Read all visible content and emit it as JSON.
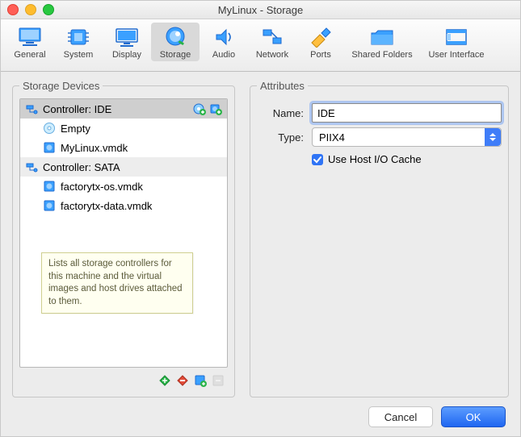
{
  "window": {
    "title": "MyLinux - Storage"
  },
  "toolbar": {
    "items": [
      {
        "label": "General"
      },
      {
        "label": "System"
      },
      {
        "label": "Display"
      },
      {
        "label": "Storage"
      },
      {
        "label": "Audio"
      },
      {
        "label": "Network"
      },
      {
        "label": "Ports"
      },
      {
        "label": "Shared Folders"
      },
      {
        "label": "User Interface"
      }
    ]
  },
  "storage": {
    "panel_title": "Storage Devices",
    "tree": {
      "ide": {
        "label": "Controller: IDE",
        "children": [
          {
            "label": "Empty"
          },
          {
            "label": "MyLinux.vmdk"
          }
        ]
      },
      "sata": {
        "label": "Controller: SATA",
        "children": [
          {
            "label": "factorytx-os.vmdk"
          },
          {
            "label": "factorytx-data.vmdk"
          }
        ]
      }
    },
    "tooltip": "Lists all storage controllers for this machine and the virtual images and host drives attached to them."
  },
  "attributes": {
    "panel_title": "Attributes",
    "name_label": "Name:",
    "name_value": "IDE",
    "type_label": "Type:",
    "type_value": "PIIX4",
    "use_host_io_label": "Use Host I/O Cache",
    "use_host_io_checked": true
  },
  "buttons": {
    "cancel": "Cancel",
    "ok": "OK"
  }
}
